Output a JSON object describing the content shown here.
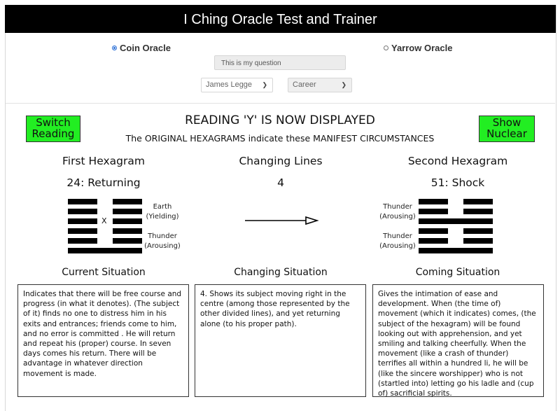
{
  "app": {
    "title": "I Ching Oracle Test and Trainer"
  },
  "oracle": {
    "options": [
      {
        "label": "Coin Oracle",
        "selected": true
      },
      {
        "label": "Yarrow Oracle",
        "selected": false
      }
    ],
    "question": {
      "value": "This is my question"
    },
    "translator_select": {
      "value": "James Legge"
    },
    "topic_select": {
      "value": "Career"
    }
  },
  "buttons": {
    "switch_reading": "Switch Reading",
    "show_nuclear": "Show Nuclear"
  },
  "reading": {
    "title": "READING 'Y' IS NOW DISPLAYED",
    "subtitle": "The ORIGINAL HEXAGRAMS indicate these MANIFEST CIRCUMSTANCES"
  },
  "columns": {
    "first": {
      "heading": "First Hexagram",
      "value": "24:  Returning"
    },
    "changing": {
      "heading": "Changing Lines",
      "value": "4"
    },
    "second": {
      "heading": "Second Hexagram",
      "value": "51:  Shock"
    }
  },
  "first_hexagram": {
    "lines_top_to_bottom": [
      "yin",
      "yin",
      "yin",
      "yin",
      "yin",
      "yang"
    ],
    "changing_line_marker": "X",
    "upper_trigram": {
      "name": "Earth",
      "quality": "(Yielding)"
    },
    "lower_trigram": {
      "name": "Thunder",
      "quality": "(Arousing)"
    }
  },
  "second_hexagram": {
    "lines_top_to_bottom": [
      "yin",
      "yin",
      "yang",
      "yin",
      "yin",
      "yang"
    ],
    "upper_trigram": {
      "name": "Thunder",
      "quality": "(Arousing)"
    },
    "lower_trigram": {
      "name": "Thunder",
      "quality": "(Arousing)"
    }
  },
  "icons": {
    "arrow": "right-arrow-icon"
  },
  "situations": {
    "current": {
      "heading": "Current Situation",
      "text": "Indicates that there will be free course and progress (in what it denotes). (The subject of it) finds no one to distress him in his exits and entrances; friends come to him, and no error is committed . He will return and repeat his (proper) course. In seven days comes his return. There will be advantage in whatever direction movement is made."
    },
    "changing": {
      "heading": "Changing Situation",
      "text": "4. Shows its subject moving right in the centre (among those represented by the other divided lines), and yet returning alone (to his proper path)."
    },
    "coming": {
      "heading": "Coming Situation",
      "text": "Gives the intimation of ease and development. When (the time of) movement (which it indicates) comes, (the subject of the hexagram) will be found looking out with apprehension, and yet smiling and talking cheerfully. When the movement (like a crash of thunder) terrifies all within a hundred li, he will be (like the sincere worshipper) who is not (startled into) letting go his ladle and (cup of) sacrificial spirits."
    }
  },
  "colors": {
    "header_bg": "#000000",
    "button_green": "#22ee22",
    "radio_selected": "#2b6fd6"
  }
}
